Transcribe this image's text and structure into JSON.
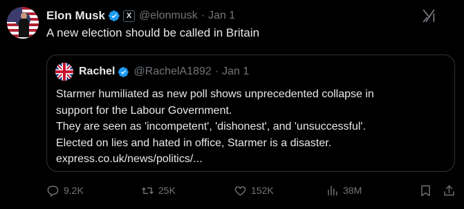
{
  "tweet": {
    "author": {
      "name": "Elon Musk",
      "handle": "@elonmusk",
      "affiliate_badge": "X"
    },
    "separator": "·",
    "date": "Jan 1",
    "text": "A new election should be called in Britain",
    "quoted": {
      "author": {
        "name": "Rachel",
        "handle": "@RachelA1892"
      },
      "separator": "·",
      "date": "Jan 1",
      "lines": [
        "Starmer humiliated as new poll shows unprecedented collapse in",
        "support for the Labour Government.",
        "They are seen as 'incompetent', 'dishonest', and 'unsuccessful'.",
        "Elected on lies and hated in office, Starmer is a disaster.",
        "express.co.uk/news/politics/..."
      ]
    },
    "actions": {
      "replies": "9.2K",
      "reposts": "25K",
      "likes": "152K",
      "views": "38M"
    }
  },
  "colors": {
    "background": "#000000",
    "text": "#e7e9ea",
    "secondary": "#71767b",
    "verified": "#1d9bf0",
    "border": "#2f3336"
  },
  "icons": {
    "verified": "verified-badge-icon",
    "grok": "grok-icon",
    "reply": "reply-icon",
    "repost": "repost-icon",
    "like": "heart-icon",
    "views": "views-chart-icon",
    "bookmark": "bookmark-icon",
    "share": "share-icon"
  }
}
